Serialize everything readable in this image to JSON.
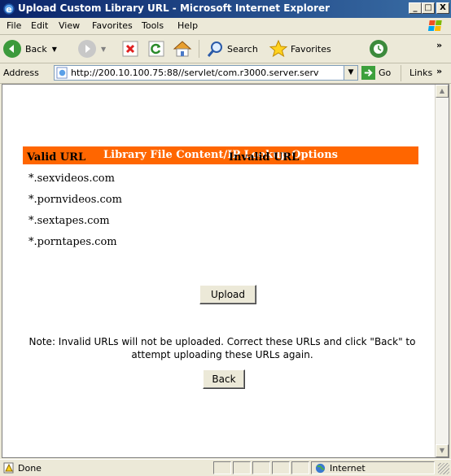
{
  "window": {
    "title": "Upload Custom Library URL - Microsoft Internet Explorer",
    "controls": {
      "minimize": "_",
      "maximize": "□",
      "close": "X"
    }
  },
  "menu": [
    "File",
    "Edit",
    "View",
    "Favorites",
    "Tools",
    "Help"
  ],
  "toolbar": {
    "back_label": "Back",
    "search_label": "Search",
    "favorites_label": "Favorites",
    "overflow": "»"
  },
  "address": {
    "label": "Address",
    "url": "http://200.10.100.75:88//servlet/com.r3000.server.serv",
    "go_label": "Go",
    "links_label": "Links",
    "links_overflow": "»"
  },
  "page": {
    "banner": "Library File Content/IP Lookup Options",
    "valid_header": "Valid URL",
    "invalid_header": "Invalid URL",
    "valid_urls": [
      "*.sexvideos.com",
      "*.pornvideos.com",
      "*.sextapes.com",
      "*.porntapes.com"
    ],
    "invalid_urls": [],
    "upload_label": "Upload",
    "note": "Note: Invalid URLs will not be uploaded. Correct these URLs and click \"Back\" to attempt uploading these URLs again.",
    "back_label": "Back"
  },
  "status": {
    "text": "Done",
    "zone": "Internet"
  },
  "colors": {
    "banner": "#ff6600",
    "titlebar": "#0a246a"
  }
}
